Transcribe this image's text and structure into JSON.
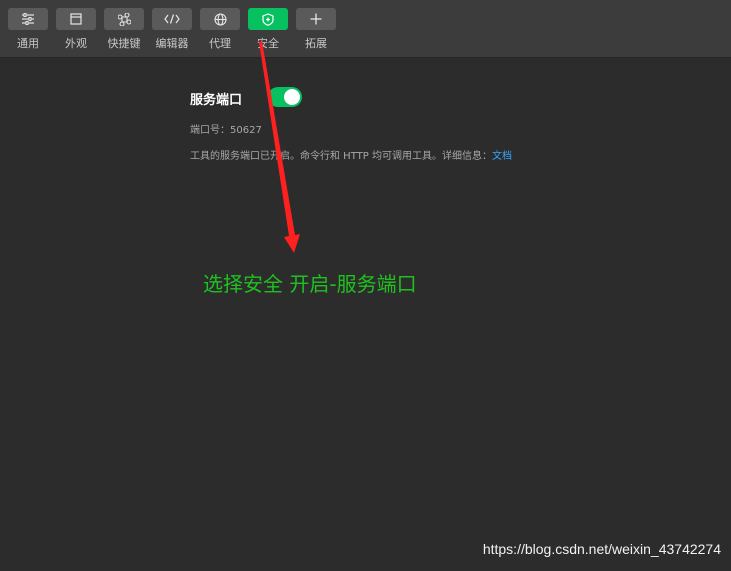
{
  "toolbar": {
    "tabs": [
      {
        "label": "通用",
        "icon": "sliders-icon"
      },
      {
        "label": "外观",
        "icon": "window-icon"
      },
      {
        "label": "快捷键",
        "icon": "command-key-icon"
      },
      {
        "label": "编辑器",
        "icon": "code-icon"
      },
      {
        "label": "代理",
        "icon": "globe-icon"
      },
      {
        "label": "安全",
        "icon": "shield-icon"
      },
      {
        "label": "拓展",
        "icon": "plus-icon"
      }
    ],
    "active_tab": "安全"
  },
  "service_port": {
    "title": "服务端口",
    "enabled": true,
    "port_text": "端口号：50627",
    "description": "工具的服务端口已开启。命令行和 HTTP 均可调用工具。详细信息：",
    "doc_link": "文档"
  },
  "annotation": {
    "text": "选择安全 开启-服务端口",
    "color": "#1ec21e"
  },
  "watermark": "https://blog.csdn.net/weixin_43742274",
  "colors": {
    "accent": "#07c160",
    "link": "#35a7ff",
    "arrow": "#ff2020"
  }
}
